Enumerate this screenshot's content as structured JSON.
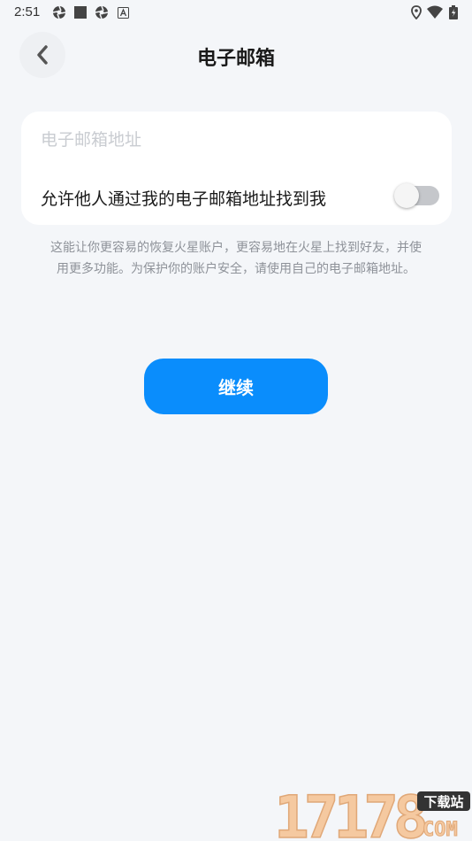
{
  "status_bar": {
    "time": "2:51"
  },
  "header": {
    "title": "电子邮箱"
  },
  "form": {
    "email_placeholder": "电子邮箱地址",
    "email_value": "",
    "allow_find_label": "允许他人通过我的电子邮箱地址找到我",
    "allow_find_enabled": false
  },
  "hint": {
    "line1": "这能让你更容易的恢复火星账户，更容易地在火星上找到好友，并使",
    "line2": "用更多功能。为保护你的账户安全，请使用自己的电子邮箱地址。"
  },
  "actions": {
    "continue_label": "继续"
  },
  "watermark": {
    "number": "17178",
    "tag": "下载站",
    "domain": "COM"
  },
  "colors": {
    "accent": "#0a8dfc",
    "background": "#f4f6f9",
    "card": "#ffffff"
  }
}
